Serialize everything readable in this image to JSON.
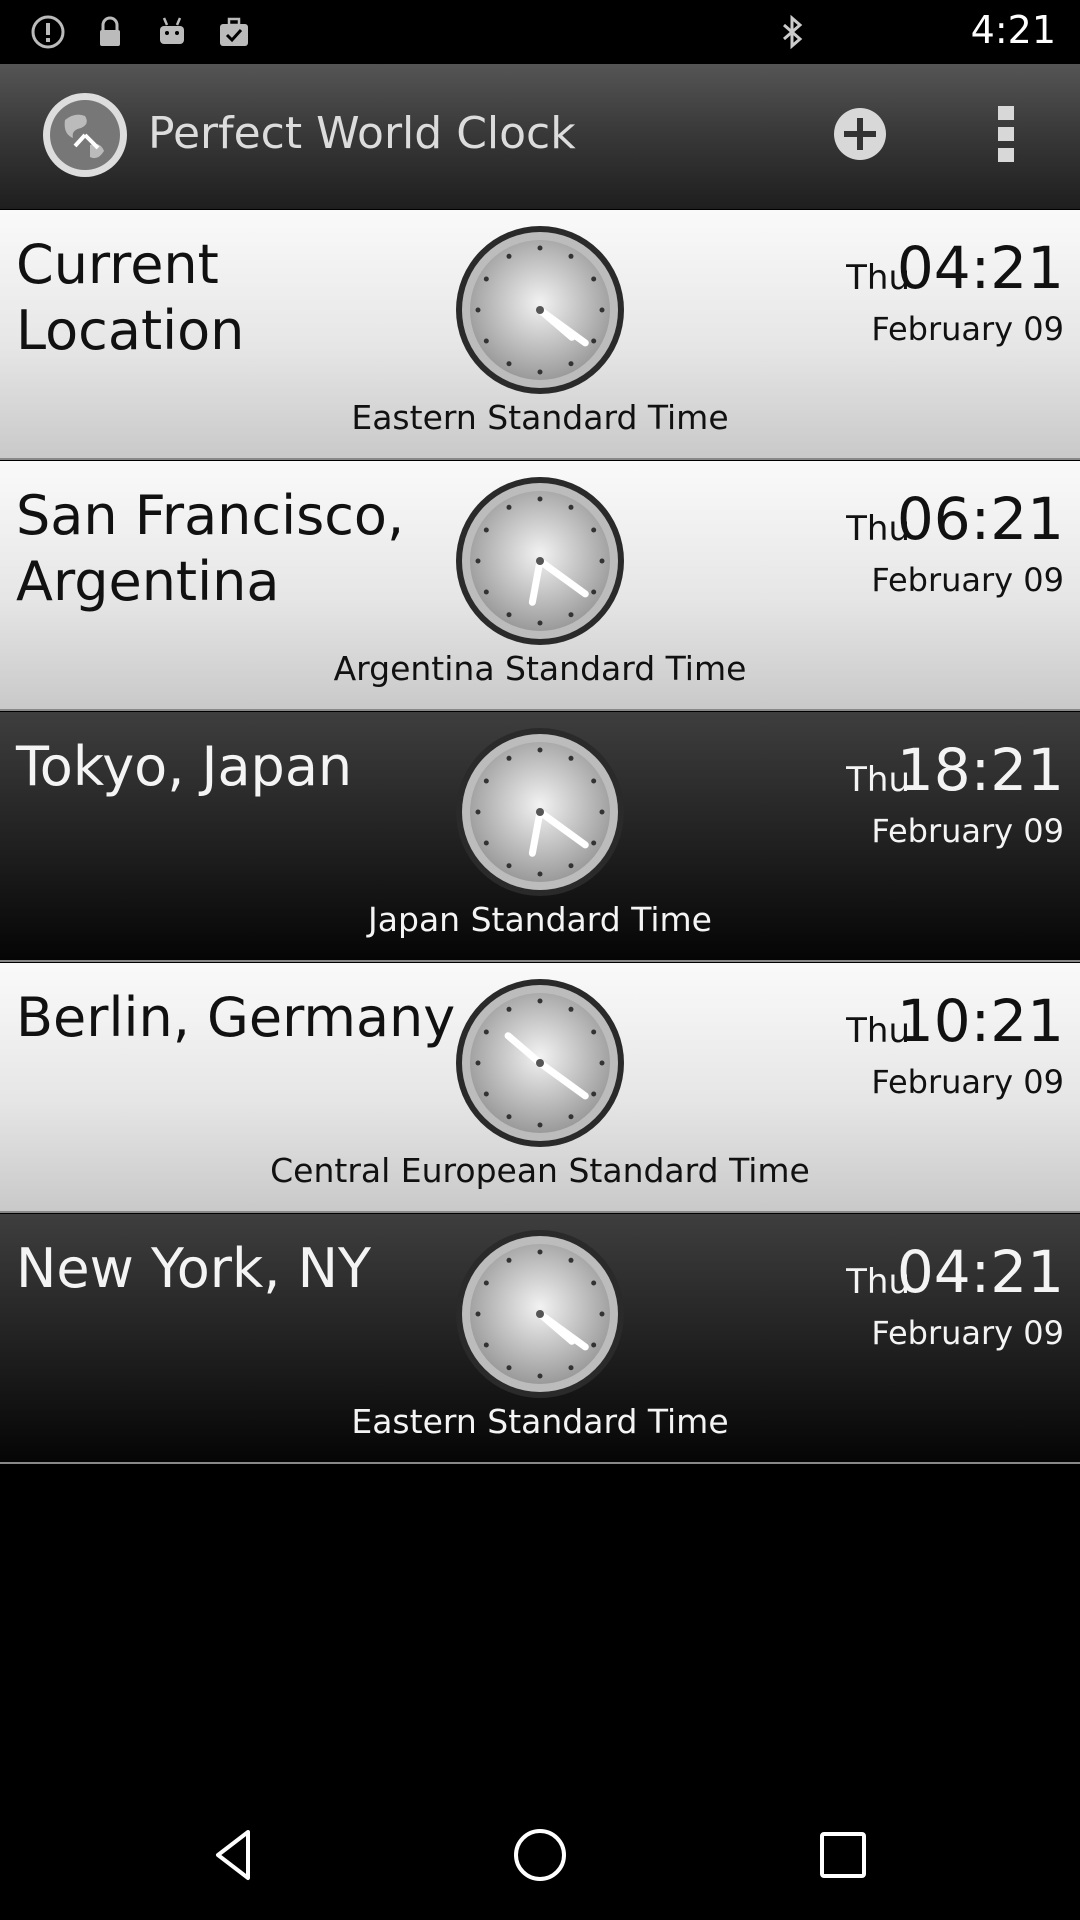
{
  "status_bar": {
    "time": "4:21",
    "left_icons": [
      "alert-icon",
      "lock-icon",
      "android-icon",
      "briefcase-check-icon"
    ],
    "right_icons": [
      "bluetooth-icon"
    ]
  },
  "app_bar": {
    "title": "Perfect World Clock",
    "logo_icon": "world-clock-logo-icon",
    "add_icon": "add-icon",
    "menu_icon": "overflow-menu-icon"
  },
  "clocks": [
    {
      "city": "Current Location",
      "day": "Thu",
      "time": "04:21",
      "date": "February 09",
      "zone": "Eastern Standard Time",
      "theme": "light",
      "hour": 4,
      "minute": 21
    },
    {
      "city": "San Francisco, Argentina",
      "day": "Thu",
      "time": "06:21",
      "date": "February 09",
      "zone": "Argentina Standard Time",
      "theme": "light",
      "hour": 6,
      "minute": 21
    },
    {
      "city": "Tokyo, Japan",
      "day": "Thu",
      "time": "18:21",
      "date": "February 09",
      "zone": "Japan Standard Time",
      "theme": "dark",
      "hour": 18,
      "minute": 21
    },
    {
      "city": "Berlin, Germany",
      "day": "Thu",
      "time": "10:21",
      "date": "February 09",
      "zone": "Central European Standard Time",
      "theme": "light",
      "hour": 10,
      "minute": 21
    },
    {
      "city": "New York, NY",
      "day": "Thu",
      "time": "04:21",
      "date": "February 09",
      "zone": "Eastern Standard Time",
      "theme": "dark",
      "hour": 4,
      "minute": 21
    }
  ],
  "nav_bar": {
    "icons": [
      "back-icon",
      "home-icon",
      "recents-icon"
    ]
  }
}
